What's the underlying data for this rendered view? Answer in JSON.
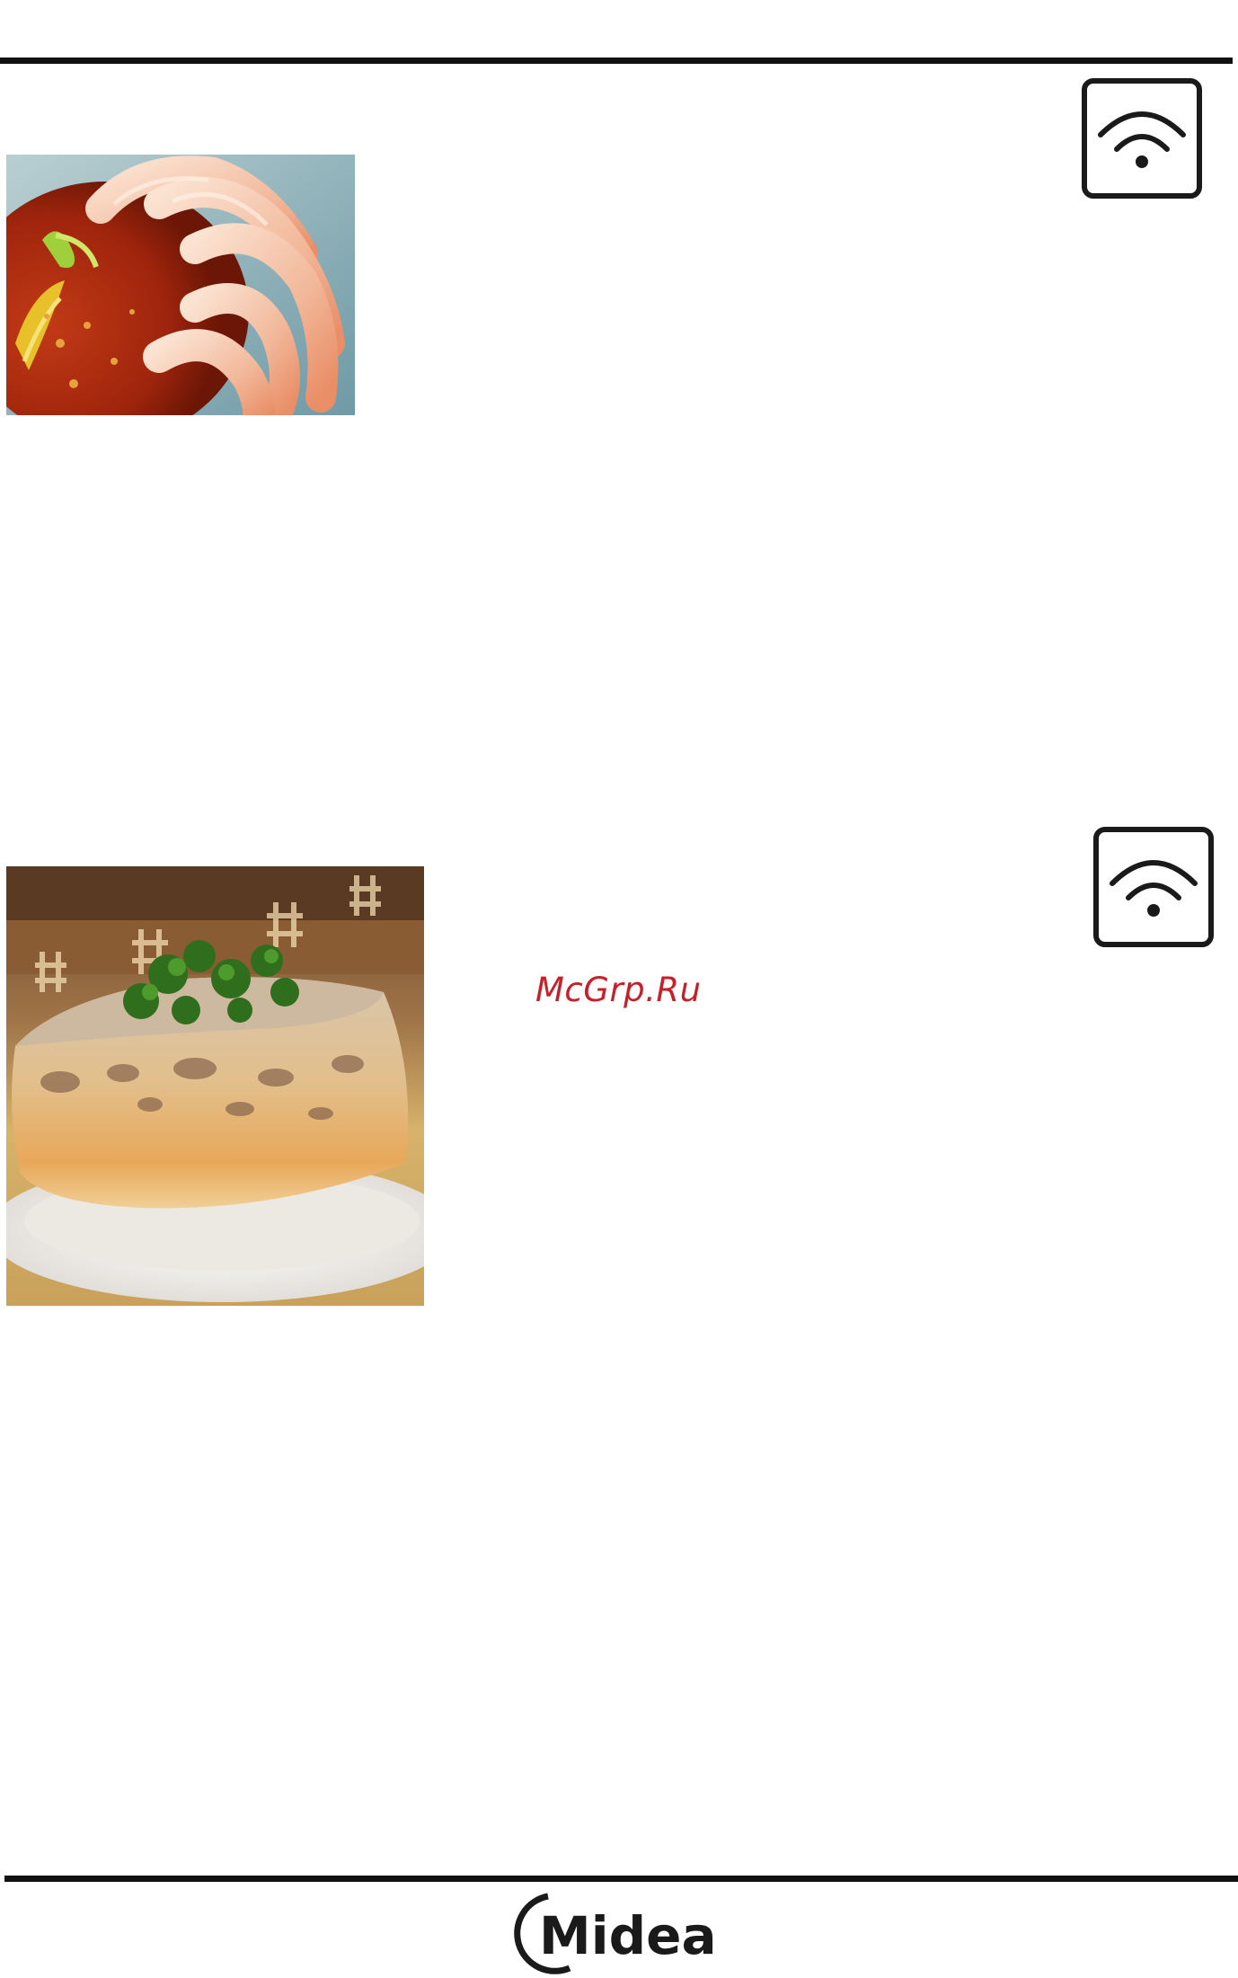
{
  "page": {
    "watermark_text": "McGrp.Ru",
    "brand_logo_text": "Midea",
    "accent_color": "#c8202a",
    "rule_color": "#111111"
  },
  "recipes": [
    {
      "photo": "shrimp-cocktail-photo",
      "mode_icon": "microwave-mode-icon"
    },
    {
      "photo": "meat-aspic-photo",
      "mode_icon": "microwave-mode-icon"
    }
  ]
}
